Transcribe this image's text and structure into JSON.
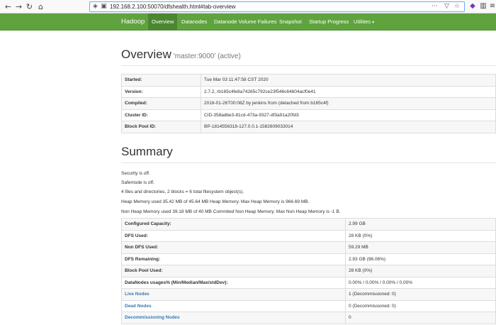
{
  "browser": {
    "url": "192.168.2.100:50070/dfshealth.html#tab-overview",
    "icons": [
      "back-icon",
      "forward-icon",
      "reload-icon",
      "home-icon",
      "shield-icon",
      "lock-icon",
      "more-icon",
      "bookmark-icon",
      "star-icon",
      "extension-icon",
      "menu-icon"
    ]
  },
  "navbar": {
    "brand": "Hadoop",
    "items": [
      {
        "label": "Overview",
        "active": true
      },
      {
        "label": "Datanodes"
      },
      {
        "label": "Datanode Volume Failures"
      },
      {
        "label": "Snapshot"
      },
      {
        "label": "Startup Progress"
      },
      {
        "label": "Utilities"
      }
    ]
  },
  "overview": {
    "title": "Overview",
    "subtitle": "'master:9000' (active)",
    "rows": [
      {
        "key": "Started:",
        "value": "Tue Mar 03 11:47:58 CST 2020"
      },
      {
        "key": "Version:",
        "value": "2.7.2, rb165c4fe8a74265c792ce23f546c64604acf0e41"
      },
      {
        "key": "Compiled:",
        "value": "2016-01-26T00:08Z by jenkins from (detached from b165c4f)"
      },
      {
        "key": "Cluster ID:",
        "value": "CID-358adbe3-81cd-473a-9327-df3a91a20fd3"
      },
      {
        "key": "Block Pool ID:",
        "value": "BP-1814556318-127.0.0.1-1582609033014"
      }
    ]
  },
  "summary": {
    "title": "Summary",
    "lines": [
      "Security is off.",
      "Safemode is off.",
      "4 files and directories, 2 blocks = 6 total filesystem object(s).",
      "Heap Memory used 35.42 MB of 45.64 MB Heap Memory. Max Heap Memory is 966.69 MB.",
      "Non Heap Memory used 39.18 MB of 40 MB Commited Non Heap Memory. Max Non Heap Memory is -1 B."
    ],
    "rows": [
      {
        "key": "Configured Capacity:",
        "value": "2.99 GB"
      },
      {
        "key": "DFS Used:",
        "value": "28 KB (0%)"
      },
      {
        "key": "Non DFS Used:",
        "value": "59.29 MB"
      },
      {
        "key": "DFS Remaining:",
        "value": "2.93 GB (98.06%)"
      },
      {
        "key": "Block Pool Used:",
        "value": "28 KB (0%)"
      },
      {
        "key": "DataNodes usages% (Min/Median/Max/stdDev):",
        "value": "0.00% / 0.00% / 0.00% / 0.00%"
      },
      {
        "key": "Live Nodes",
        "value": "1 (Decommissioned: 0)",
        "link": true
      },
      {
        "key": "Dead Nodes",
        "value": "0 (Decommissioned: 0)",
        "link": true
      },
      {
        "key": "Decommissioning Nodes",
        "value": "0",
        "link": true
      }
    ]
  }
}
